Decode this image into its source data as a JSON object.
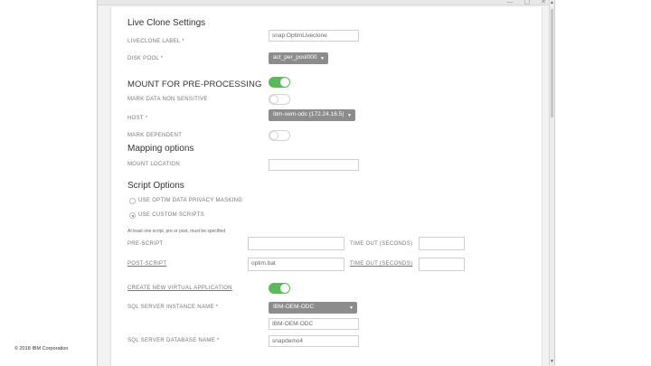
{
  "window": {
    "controls": "— ▢ ✕"
  },
  "live_clone_settings": {
    "title": "Live Clone Settings",
    "livecone_label": {
      "label": "LIVECLONE LABEL *",
      "value": "snap:OptimLiveclone"
    },
    "disk_pool": {
      "label": "DISK POOL *",
      "value": "act_per_pool000"
    }
  },
  "pre_processing": {
    "title": "MOUNT FOR PRE-PROCESSING",
    "enabled": true,
    "mark_non_sensitive": {
      "label": "MARK DATA NON SENSITIVE",
      "enabled": false
    },
    "host": {
      "label": "HOST *",
      "value": "ibm-oem-odc (172.24.16.5)"
    },
    "mark_dependent": {
      "label": "MARK DEPENDENT",
      "enabled": false
    }
  },
  "mapping_options": {
    "title": "Mapping options",
    "mount_location": {
      "label": "MOUNT LOCATION",
      "value": ""
    }
  },
  "script_options": {
    "title": "Script Options",
    "radio_masking": {
      "label": "USE OPTIM DATA PRIVACY MASKING",
      "selected": false
    },
    "radio_custom": {
      "label": "USE CUSTOM SCRIPTS",
      "selected": true
    },
    "note": "At least one script, pre or post, must be specified",
    "pre_script": {
      "label": "PRE-SCRIPT",
      "value": "",
      "timeout_label": "TIME OUT (SECONDS)",
      "timeout_value": ""
    },
    "post_script": {
      "label": "POST-SCRIPT",
      "value": "optim.bat",
      "timeout_label": "TIME OUT (SECONDS)",
      "timeout_value": ""
    }
  },
  "virtual_app": {
    "create": {
      "label": "CREATE NEW VIRTUAL APPLICATION",
      "enabled": true
    },
    "sql_instance": {
      "label": "SQL SERVER INSTANCE NAME *",
      "value": "IBM-OEM-ODC",
      "text_value": "IBM-OEM-ODC"
    },
    "sql_database": {
      "label": "SQL SERVER DATABASE NAME *",
      "value": "snapdemo4"
    }
  },
  "footer": {
    "copyright": "© 2018 IBM Corporation"
  },
  "colors": {
    "toggle_on": "#5cb85c",
    "dropdown": "#8c8c8c"
  }
}
